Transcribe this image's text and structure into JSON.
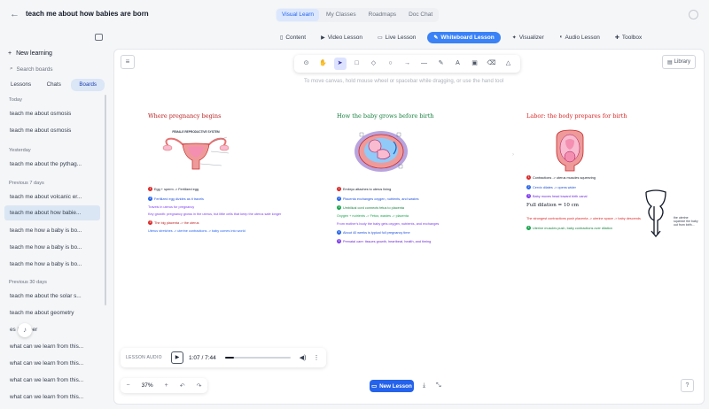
{
  "header": {
    "back_icon": "arrow-left-icon",
    "title": "teach me about how babies are born",
    "tabs": [
      "Visual Learn",
      "My Classes",
      "Roadmaps",
      "Doc Chat"
    ],
    "active_tab": 0
  },
  "modes": {
    "items": [
      {
        "label": "Content",
        "icon": "book-icon"
      },
      {
        "label": "Video Lesson",
        "icon": "video-icon"
      },
      {
        "label": "Live Lesson",
        "icon": "live-icon"
      },
      {
        "label": "Whiteboard Lesson",
        "icon": "whiteboard-icon"
      },
      {
        "label": "Visualizer",
        "icon": "sparkle-icon"
      },
      {
        "label": "Audio Lesson",
        "icon": "audio-icon"
      },
      {
        "label": "Toolbox",
        "icon": "toolbox-icon"
      }
    ],
    "active": 3
  },
  "sidebar": {
    "new_learning": "New learning",
    "search_placeholder": "Search boards",
    "tabs": [
      "Lessons",
      "Chats",
      "Boards"
    ],
    "active_tab": 2,
    "sections": [
      {
        "label": "Today",
        "items": [
          "teach me about osmosis",
          "teach me about osmosis"
        ]
      },
      {
        "label": "Yesterday",
        "items": [
          "teach me about the pythag..."
        ]
      },
      {
        "label": "Previous 7 days",
        "items": [
          "teach me about volcanic er...",
          "teach me about how babie...",
          "teach me how a baby is bo...",
          "teach me how a baby is bo...",
          "teach me how a baby is bo..."
        ]
      },
      {
        "label": "Previous 30 days",
        "items": [
          "teach me about the solar s...",
          "teach me about geometry",
          "es        is paper",
          "what can we learn from this...",
          "what can we learn from this...",
          "what can we learn from this...",
          "what can we learn from this..."
        ]
      }
    ],
    "active_item": "teach me about how babie..."
  },
  "canvas": {
    "toolbar_tools": [
      "lock-icon",
      "hand-icon",
      "pointer-icon",
      "rectangle-icon",
      "diamond-icon",
      "circle-icon",
      "arrow-icon",
      "line-icon",
      "pencil-icon",
      "text-icon",
      "image-icon",
      "eraser-icon",
      "shapes-icon"
    ],
    "active_tool": 2,
    "hint": "To move canvas, hold mouse wheel or spacebar while dragging, or use the hand tool",
    "library_label": "Library",
    "columns": [
      {
        "title": "Where pregnancy begins",
        "color": "#b91c1c",
        "diagram_title": "FEMALE REPRODUCTIVE SYSTEM",
        "lines": [
          {
            "num": "1",
            "text": "Egg + sperm -> Fertilized egg",
            "color": "#dc2626"
          },
          {
            "num": "2",
            "text": "Fertilized egg divides as it travels",
            "color": "#2563eb"
          },
          {
            "text": "Travels in uterus for pregnancy",
            "color": "#7c3aed"
          },
          {
            "text": "Key growth: pregnancy grows in the uterus, but little cells that keep the uterus safe longer",
            "color": "#7c3aed"
          },
          {
            "num": "3",
            "text": "The big placenta -> the uterus",
            "color": "#dc2626"
          },
          {
            "text": "Uterus stretches -> uterine contractions -> baby comes into world",
            "color": "#2563eb"
          }
        ]
      },
      {
        "title": "How the baby grows before birth",
        "color": "#15803d",
        "lines": [
          {
            "num": "1",
            "text": "Embryo attaches to uterus lining",
            "color": "#dc2626"
          },
          {
            "num": "2",
            "text": "Placenta exchanges oxygen, nutrients, and wastes",
            "color": "#2563eb"
          },
          {
            "num": "3",
            "text": "Umbilical cord connects fetus to placenta",
            "color": "#16a34a"
          },
          {
            "text": "Oxygen + nutrients -> Fetus; wastes -> placenta",
            "color": "#16a34a"
          },
          {
            "text": "From mother's body the baby gets oxygen, nutrients, and exchanges",
            "color": "#7c3aed"
          },
          {
            "num": "4",
            "text": "About 40 weeks is typical full pregnancy time",
            "color": "#2563eb"
          },
          {
            "num": "5",
            "text": "Prenatal care: tissues growth, heartbeat, health, and timing",
            "color": "#7c3aed"
          }
        ]
      },
      {
        "title": "Labor: the body prepares for birth",
        "color": "#dc2626",
        "lines": [
          {
            "num": "1",
            "text": "Contractions -> uterus muscles squeezing",
            "color": "#dc2626"
          },
          {
            "num": "2",
            "text": "Cervix dilates -> opens wider",
            "color": "#2563eb"
          },
          {
            "num": "3",
            "text": "Baby moves head toward birth canal",
            "color": "#7c3aed"
          },
          {
            "text": "Full dilation = 10 cm",
            "color": "#111827",
            "big": true
          },
          {
            "text": "The strongest contractions push placenta -> uterine space -> baby descends",
            "color": "#dc2626"
          },
          {
            "num": "4",
            "text": "Uterine muscles push, baby contractions over dilation",
            "color": "#16a34a"
          }
        ]
      }
    ],
    "side_note": "the uterine squeeze the baby out from birth..."
  },
  "audio": {
    "label": "LESSON AUDIO",
    "time": "1:07 / 7:44",
    "progress": 0.144,
    "volume_icon": "volume-icon",
    "more_icon": "more-vertical-icon"
  },
  "zoom": {
    "minus": "−",
    "value": "37%",
    "plus": "+",
    "undo": "↶",
    "redo": "↷"
  },
  "bottom": {
    "new_lesson": "New Lesson",
    "download_icon": "download-icon",
    "fullscreen_icon": "fullscreen-icon",
    "help_icon": "help-icon"
  }
}
